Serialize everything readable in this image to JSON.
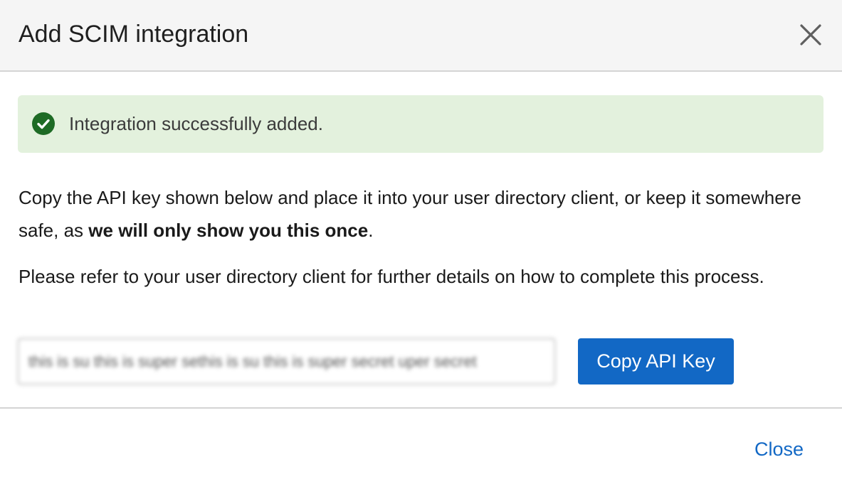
{
  "dialog": {
    "title": "Add SCIM integration",
    "close_icon": "close-icon"
  },
  "alert": {
    "icon": "check-circle-icon",
    "message": "Integration successfully added.",
    "color_bg": "#e3f1dd",
    "color_icon": "#1e6b25"
  },
  "instructions": {
    "para1_before": "Copy the API key shown below and place it into your user directory client, or keep it somewhere safe, as ",
    "para1_bold": "we will only show you this once",
    "para1_after": ".",
    "para2": "Please refer to your user directory client for further details on how to complete this process."
  },
  "api_key": {
    "value": "this is su this is super sethis is su this is super secret uper secret"
  },
  "buttons": {
    "copy_label": "Copy API Key",
    "close_label": "Close",
    "accent": "#1268c5"
  }
}
